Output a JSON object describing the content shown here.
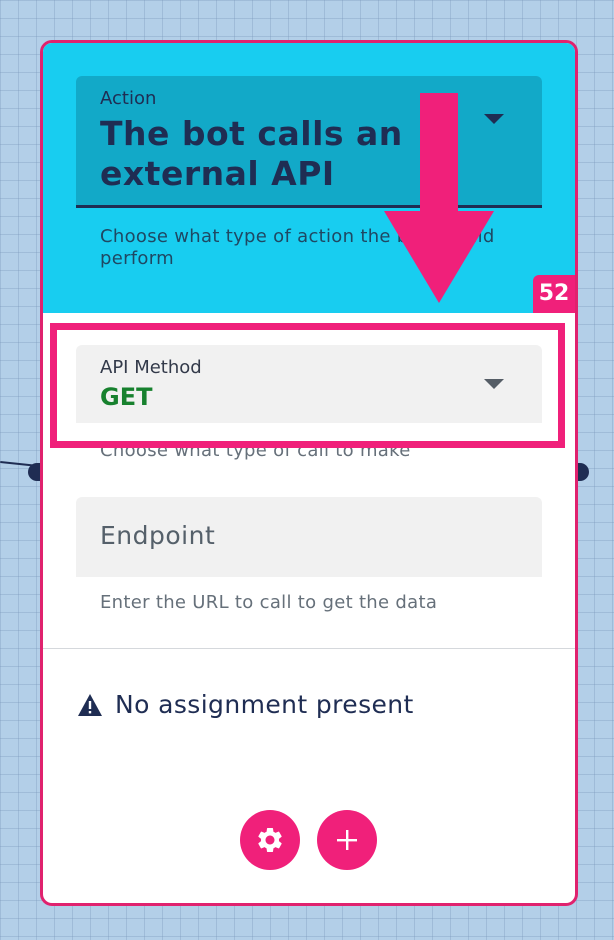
{
  "action": {
    "label": "Action",
    "value": "The bot calls an external API",
    "helper": "Choose what type of action the bot should perform"
  },
  "badge": {
    "count": "52"
  },
  "api_method": {
    "label": "API Method",
    "value": "GET",
    "helper": "Choose what type of call to make"
  },
  "endpoint": {
    "placeholder": "Endpoint",
    "helper": "Enter the URL to call to get the data"
  },
  "assignment": {
    "message": "No assignment present"
  },
  "buttons": {
    "settings_icon": "gear-icon",
    "add_icon": "plus-icon"
  },
  "colors": {
    "accent": "#f0207a",
    "header": "#18cdf0",
    "method_value": "#17812e",
    "text": "#1f2d53"
  }
}
